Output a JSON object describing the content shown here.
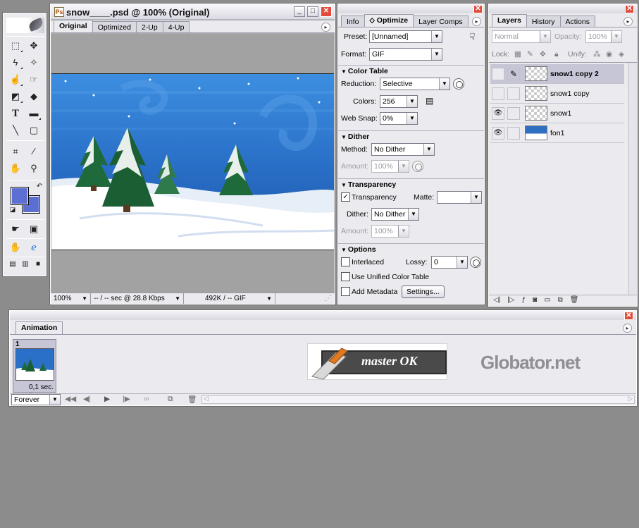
{
  "document": {
    "title": "snow____.psd @ 100% (Original)",
    "tabs": [
      "Original",
      "Optimized",
      "2-Up",
      "4-Up"
    ],
    "active_tab": "Original",
    "zoom": "100%",
    "download_time": "-- / -- sec @ 28.8 Kbps",
    "file_info": "492K / -- GIF",
    "scene_colors": {
      "sky": "#2f78d2",
      "snow": "#ffffff",
      "tree": "#1f6a3a"
    }
  },
  "optimize": {
    "tabs": [
      "Info",
      "Optimize",
      "Layer Comps"
    ],
    "active_tab": "Optimize",
    "preset": {
      "label": "Preset:",
      "value": "[Unnamed]"
    },
    "format": {
      "label": "Format:",
      "value": "GIF"
    },
    "color_table": {
      "title": "Color Table",
      "reduction": {
        "label": "Reduction:",
        "value": "Selective"
      },
      "colors": {
        "label": "Colors:",
        "value": "256"
      },
      "web_snap": {
        "label": "Web Snap:",
        "value": "0%"
      }
    },
    "dither": {
      "title": "Dither",
      "method": {
        "label": "Method:",
        "value": "No Dither"
      },
      "amount": {
        "label": "Amount:",
        "value": "100%"
      }
    },
    "transparency": {
      "title": "Transparency",
      "checkbox_label": "Transparency",
      "matte_label": "Matte:",
      "dither": {
        "label": "Dither:",
        "value": "No Dither"
      },
      "amount": {
        "label": "Amount:",
        "value": "100%"
      }
    },
    "options": {
      "title": "Options",
      "interlaced": "Interlaced",
      "lossy": {
        "label": "Lossy:",
        "value": "0"
      },
      "unified": "Use Unified Color Table",
      "metadata": "Add Metadata",
      "settings_button": "Settings..."
    }
  },
  "layers": {
    "tabs": [
      "Layers",
      "History",
      "Actions"
    ],
    "active_tab": "Layers",
    "blend_mode": "Normal",
    "opacity_label": "Opacity:",
    "opacity_value": "100%",
    "lock_label": "Lock:",
    "unify_label": "Unify:",
    "items": [
      {
        "name": "snow1 copy 2",
        "visible": false,
        "active": true
      },
      {
        "name": "snow1 copy",
        "visible": false,
        "active": false
      },
      {
        "name": "snow1",
        "visible": true,
        "active": false
      },
      {
        "name": "fon1",
        "visible": true,
        "active": false
      }
    ]
  },
  "animation": {
    "tab": "Animation",
    "frame_number": "1",
    "frame_delay": "0,1 sec.",
    "loop": "Forever",
    "logo_master": "master OK",
    "logo_globator": "Globator.net"
  },
  "tools": {
    "foreground_color": "#5e6fd4",
    "background_color": "#5b6ed2"
  }
}
